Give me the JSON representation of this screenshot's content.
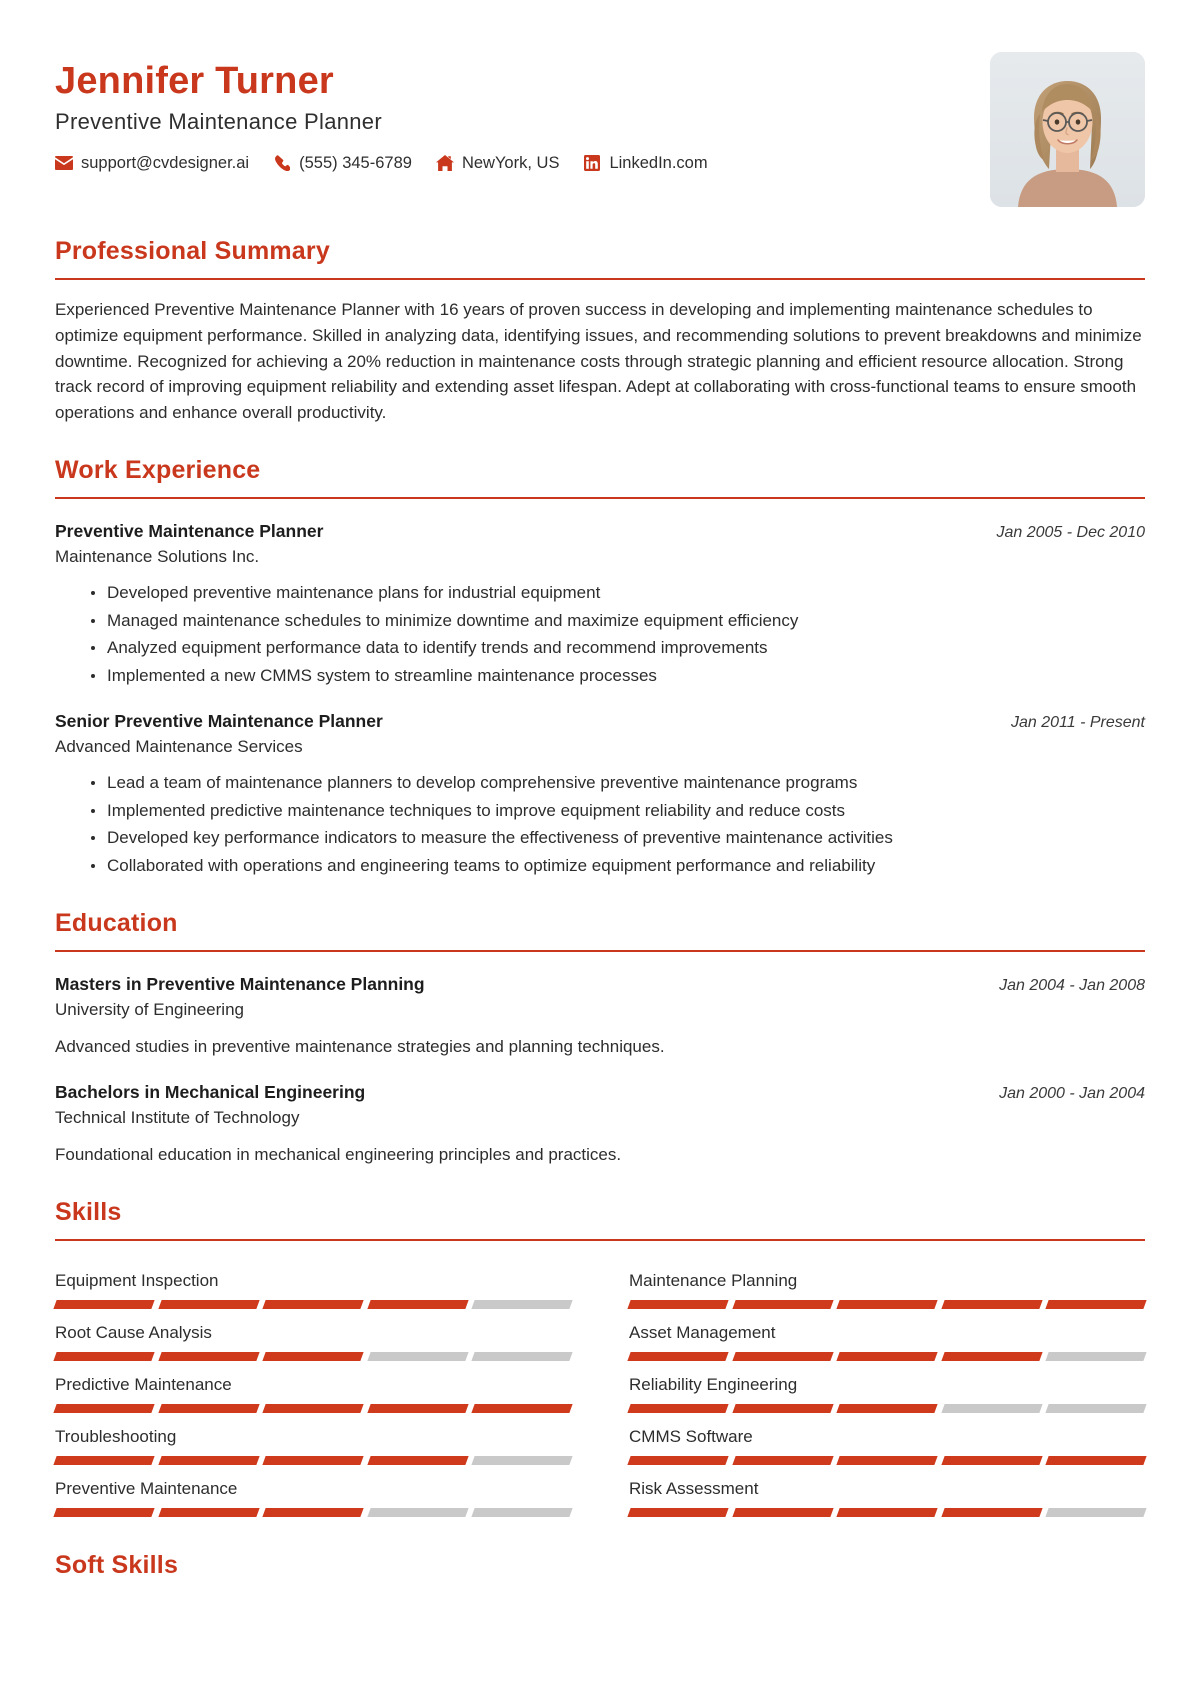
{
  "colors": {
    "accent": "#c9381d",
    "skill_fill": "#cf3a1c",
    "skill_empty": "#c9c9c9",
    "text": "#2d2d2d"
  },
  "header": {
    "name": "Jennifer Turner",
    "title": "Preventive Maintenance Planner",
    "contacts": [
      {
        "icon": "envelope-icon",
        "value": "support@cvdesigner.ai"
      },
      {
        "icon": "phone-icon",
        "value": "(555) 345-6789"
      },
      {
        "icon": "home-icon",
        "value": "NewYork, US"
      },
      {
        "icon": "linkedin-icon",
        "value": "LinkedIn.com"
      }
    ]
  },
  "summary": {
    "heading": "Professional Summary",
    "text": "Experienced Preventive Maintenance Planner with 16 years of proven success in developing and implementing maintenance schedules to optimize equipment performance. Skilled in analyzing data, identifying issues, and recommending solutions to prevent breakdowns and minimize downtime. Recognized for achieving a 20% reduction in maintenance costs through strategic planning and efficient resource allocation. Strong track record of improving equipment reliability and extending asset lifespan. Adept at collaborating with cross-functional teams to ensure smooth operations and enhance overall productivity."
  },
  "experience": {
    "heading": "Work Experience",
    "entries": [
      {
        "title": "Preventive Maintenance Planner",
        "date": "Jan 2005 - Dec 2010",
        "org": "Maintenance Solutions Inc.",
        "bullets": [
          "Developed preventive maintenance plans for industrial equipment",
          "Managed maintenance schedules to minimize downtime and maximize equipment efficiency",
          "Analyzed equipment performance data to identify trends and recommend improvements",
          "Implemented a new CMMS system to streamline maintenance processes"
        ]
      },
      {
        "title": "Senior Preventive Maintenance Planner",
        "date": "Jan 2011 - Present",
        "org": "Advanced Maintenance Services",
        "bullets": [
          "Lead a team of maintenance planners to develop comprehensive preventive maintenance programs",
          "Implemented predictive maintenance techniques to improve equipment reliability and reduce costs",
          "Developed key performance indicators to measure the effectiveness of preventive maintenance activities",
          "Collaborated with operations and engineering teams to optimize equipment performance and reliability"
        ]
      }
    ]
  },
  "education": {
    "heading": "Education",
    "entries": [
      {
        "title": "Masters in Preventive Maintenance Planning",
        "date": "Jan 2004 - Jan 2008",
        "org": "University of Engineering",
        "desc": "Advanced studies in preventive maintenance strategies and planning techniques."
      },
      {
        "title": "Bachelors in Mechanical Engineering",
        "date": "Jan 2000 - Jan 2004",
        "org": "Technical Institute of Technology",
        "desc": "Foundational education in mechanical engineering principles and practices."
      }
    ]
  },
  "skills": {
    "heading": "Skills",
    "segments_total": 5,
    "items": [
      {
        "name": "Equipment Inspection",
        "level": 4
      },
      {
        "name": "Maintenance Planning",
        "level": 5
      },
      {
        "name": "Root Cause Analysis",
        "level": 3
      },
      {
        "name": "Asset Management",
        "level": 4
      },
      {
        "name": "Predictive Maintenance",
        "level": 5
      },
      {
        "name": "Reliability Engineering",
        "level": 3
      },
      {
        "name": "Troubleshooting",
        "level": 4
      },
      {
        "name": "CMMS Software",
        "level": 5
      },
      {
        "name": "Preventive Maintenance",
        "level": 3
      },
      {
        "name": "Risk Assessment",
        "level": 4
      }
    ]
  },
  "soft_skills": {
    "heading": "Soft Skills"
  }
}
